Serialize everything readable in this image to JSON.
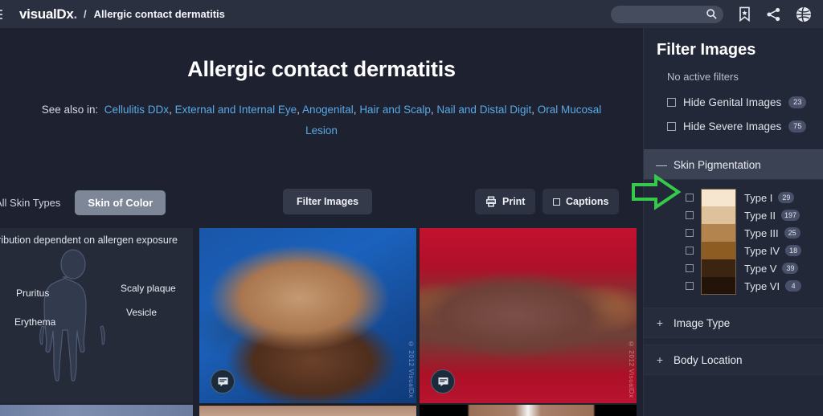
{
  "topbar": {
    "menu_icon": "hamburger-menu-icon",
    "brand": "visualDx",
    "brand_dot": ".",
    "breadcrumb_separator": "/",
    "breadcrumb": "Allergic contact dermatitis",
    "search_placeholder": "",
    "search_value": "",
    "icons": [
      "search-icon",
      "bookmark-star-icon",
      "share-icon",
      "globe-icon"
    ]
  },
  "hero": {
    "title": "Allergic contact dermatitis",
    "see_also_label": "See also in:",
    "see_also_links": [
      "Cellulitis DDx",
      "External and Internal Eye",
      "Anogenital",
      "Hair and Scalp",
      "Nail and Distal Digit",
      "Oral Mucosal Lesion"
    ]
  },
  "toolbar": {
    "tab_all": "All Skin Types",
    "tab_skin_of_color": "Skin of Color",
    "active_tab": "Skin of Color",
    "filter_images": "Filter Images",
    "print": "Print",
    "captions": "Captions"
  },
  "grid": {
    "diagram": {
      "caption": "Rash distribution dependent on allergen exposure",
      "caption_visible": "sh distribution dependent on allergen exposure",
      "labels": [
        "Pruritus",
        "Erythema",
        "Scaly plaque",
        "Vesicle"
      ]
    },
    "photos": [
      {
        "alt": "hands with allergic contact dermatitis on blue drape",
        "watermark": "© 2012 VisualDx",
        "caption_icon": "caption-bubble-icon"
      },
      {
        "alt": "lower leg with lichenified dermatitis on red drape",
        "watermark": "© 2012 VisualDx",
        "caption_icon": "caption-bubble-icon"
      }
    ]
  },
  "panel": {
    "title": "Filter Images",
    "no_active_filters": "No active filters",
    "checkboxes": [
      {
        "label": "Hide Genital Images",
        "count": "23",
        "checked": false
      },
      {
        "label": "Hide Severe Images",
        "count": "75",
        "checked": false
      }
    ],
    "sections": [
      {
        "label": "Skin Pigmentation",
        "toggle": "—",
        "expanded": true
      },
      {
        "label": "Image Type",
        "toggle": "+",
        "expanded": false
      },
      {
        "label": "Body Location",
        "toggle": "+",
        "expanded": false
      }
    ],
    "pigment_types": [
      {
        "label": "Type I",
        "count": "29",
        "swatch": "#f6e6cf",
        "checked": false
      },
      {
        "label": "Type II",
        "count": "197",
        "swatch": "#ddc29c",
        "checked": false
      },
      {
        "label": "Type III",
        "count": "25",
        "swatch": "#b4844f",
        "checked": false
      },
      {
        "label": "Type IV",
        "count": "18",
        "swatch": "#8c5c23",
        "checked": false
      },
      {
        "label": "Type V",
        "count": "39",
        "swatch": "#3b2410",
        "checked": false
      },
      {
        "label": "Type VI",
        "count": "4",
        "swatch": "#231308",
        "checked": false
      }
    ]
  },
  "annotation": {
    "arrow_color": "#35c84b",
    "arrow_name": "pointer-arrow-annotation",
    "points_to": "Skin Pigmentation"
  },
  "colors": {
    "topbar_bg": "#2b3040",
    "main_bg": "#1d2130",
    "panel_bg": "#232838",
    "link": "#5aa9e6",
    "active_tab_bg": "#7e8798",
    "section_active_bg": "#3a4254",
    "badge_bg": "#49516a"
  }
}
